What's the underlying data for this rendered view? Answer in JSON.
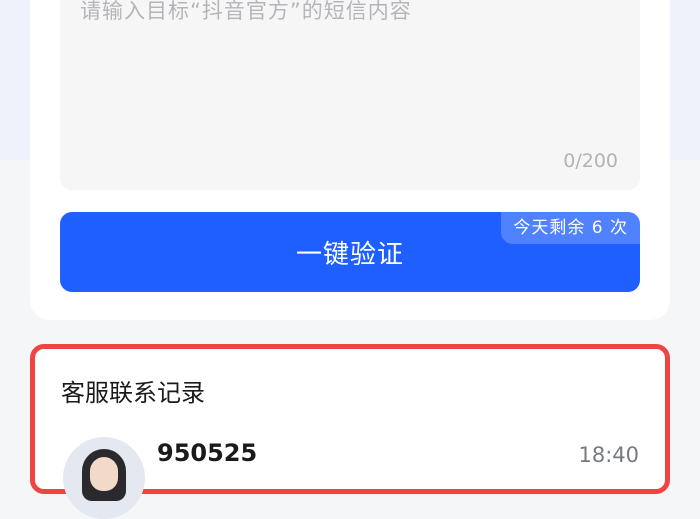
{
  "sms_input": {
    "placeholder": "请输入目标“抖音官方”的短信内容",
    "counter": "0/200"
  },
  "verify_button": {
    "label": "一键验证",
    "remaining_badge": "今天剩余 6 次"
  },
  "contact_records": {
    "title": "客服联系记录",
    "items": [
      {
        "number": "950525",
        "time": "18:40"
      }
    ]
  },
  "colors": {
    "primary_button": "#1f5eff",
    "highlight_border": "#ef4444",
    "page_background": "#f5f6f8"
  }
}
